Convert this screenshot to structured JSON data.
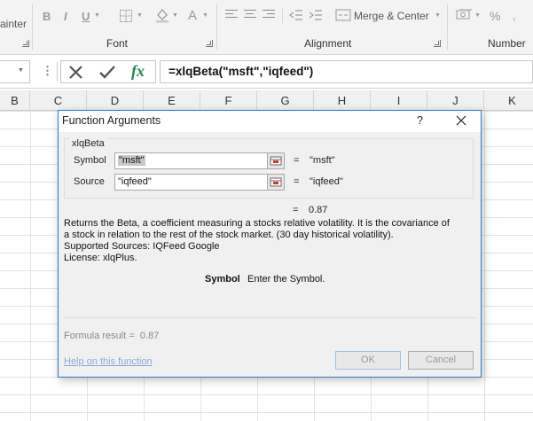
{
  "ribbon": {
    "painter_label": "ainter",
    "bold": "B",
    "italic": "I",
    "underline": "U",
    "font_color_glyph": "A",
    "merge_center_label": "Merge & Center",
    "percent": "%",
    "groups": {
      "font": "Font",
      "alignment": "Alignment",
      "number": "Number"
    }
  },
  "formula_bar": {
    "dots": "⋮",
    "fx": "fx",
    "formula": "=xlqBeta(\"msft\",\"iqfeed\")"
  },
  "columns": [
    "B",
    "C",
    "D",
    "E",
    "F",
    "G",
    "H",
    "I",
    "J",
    "K"
  ],
  "dialog": {
    "title": "Function Arguments",
    "help": "?",
    "function_name": "xlqBeta",
    "args": [
      {
        "label": "Symbol",
        "value": "\"msft\"",
        "result": "\"msft\""
      },
      {
        "label": "Source",
        "value": "\"iqfeed\"",
        "result": "\"iqfeed\""
      }
    ],
    "eq": "=",
    "function_result": "0.87",
    "description": [
      "Returns the Beta, a coefficient measuring a stocks relative volatility. It is the covariance of",
      "a stock in relation to the rest of the stock market. (30 day historical volatility).",
      "Supported Sources:  IQFeed Google",
      "License: xlqPlus."
    ],
    "arg_desc_name": "Symbol",
    "arg_desc_text": "Enter the Symbol.",
    "formula_result_label": "Formula result =",
    "formula_result_value": "0.87",
    "help_link": "Help on this function",
    "ok_label": "OK",
    "cancel_label": "Cancel"
  }
}
